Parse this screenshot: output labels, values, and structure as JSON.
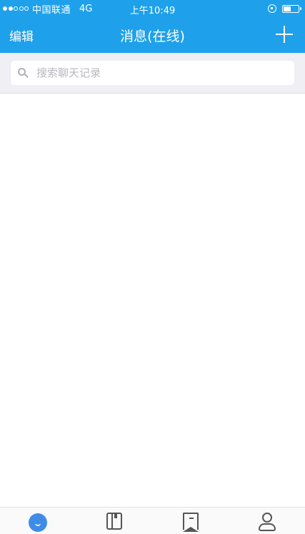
{
  "status_bar": {
    "carrier": "中国联通",
    "network": "4G",
    "time": "上午10:49",
    "signal_strength": 2,
    "signal_max": 5,
    "battery_level": 0.55
  },
  "nav_bar": {
    "edit_label": "编辑",
    "title": "消息(在线)",
    "add_icon": "plus-icon"
  },
  "search": {
    "placeholder": "搜索聊天记录",
    "value": ""
  },
  "tab_bar": {
    "tabs": [
      {
        "icon": "message-icon",
        "active": true
      },
      {
        "icon": "book-icon",
        "active": false
      },
      {
        "icon": "bookmark-icon",
        "active": false
      },
      {
        "icon": "person-icon",
        "active": false
      }
    ]
  },
  "colors": {
    "accent": "#1ea1ea",
    "tab_active": "#3f8ce6",
    "search_bg": "#efeff4"
  }
}
